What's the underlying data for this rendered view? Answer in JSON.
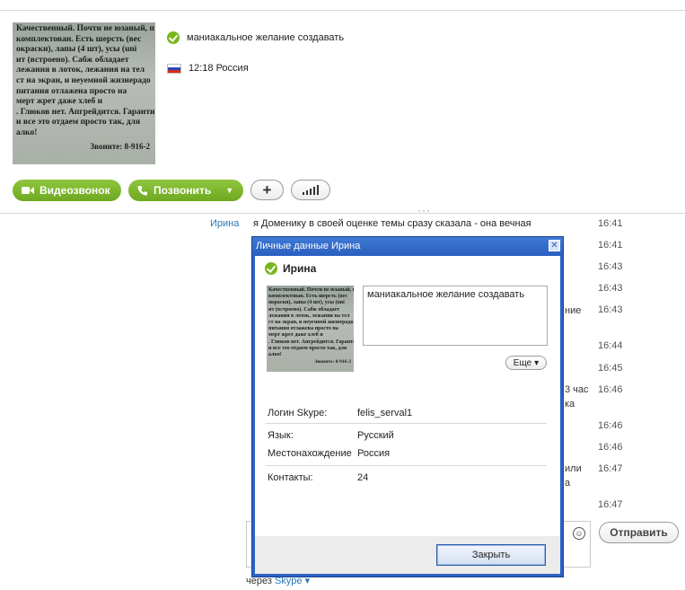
{
  "profile": {
    "avatar_text": "Качественный. Почти не юзаный, п\nкомплектован. Есть шерсть (вес\nокраски), лапы (4 шт), усы (uni\nит (встроено). Сабж обладает\nлежания в лоток, лежания на тел\nст на экран, и неуемной жизнерадо\nпитания отлажена просто на\nмерт жрет даже хлеб и\n. Глюков нет. Апгрейдится. Гаранти\nи все это отдаем просто так, для\nалко!",
    "avatar_phone": "Звоните: 8-916-2",
    "mood": "маниакальное желание создавать",
    "location": "12:18 Россия"
  },
  "actions": {
    "video_call": "Видеозвонок",
    "call": "Позвонить",
    "add": "+"
  },
  "chat": {
    "sender": "Ирина",
    "message": "я Доменику в своей оценке темы сразу сказала - она вечная",
    "timestamps": [
      "16:41",
      "16:41",
      "16:43",
      "16:43",
      "16:43",
      "16:44",
      "16:45",
      "16:46",
      "16:46",
      "16:46",
      "16:47",
      "16:47"
    ],
    "fragments": [
      "ние",
      "3 час",
      "ка",
      "или",
      "а"
    ],
    "send_label": "Отправить",
    "via_label": "через",
    "via_link": "Skype"
  },
  "dialog": {
    "title": "Личные данные Ирина",
    "close_x": "✕",
    "name": "Ирина",
    "mood": "маниакальное желание создавать",
    "more_label": "Еще",
    "skype_login_label": "Логин Skype:",
    "skype_login": "felis_serval1",
    "language_label": "Язык:",
    "language": "Русский",
    "location_label": "Местонахождение",
    "location": "Россия",
    "contacts_label": "Контакты:",
    "contacts": "24",
    "close_button": "Закрыть"
  },
  "colors": {
    "accent_green": "#7ab51d",
    "link_blue": "#2a7ab8",
    "dialog_blue": "#2c63c6"
  }
}
